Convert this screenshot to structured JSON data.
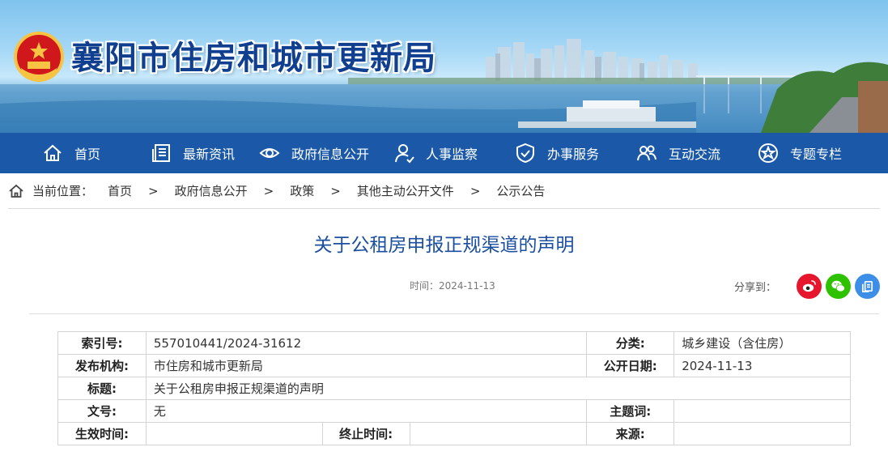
{
  "site": {
    "title": "襄阳市住房和城市更新局"
  },
  "nav": {
    "items": [
      {
        "label": "首页",
        "icon": "home-icon"
      },
      {
        "label": "最新资讯",
        "icon": "news-icon"
      },
      {
        "label": "政府信息公开",
        "icon": "eye-icon"
      },
      {
        "label": "人事监察",
        "icon": "person-icon"
      },
      {
        "label": "办事服务",
        "icon": "shield-icon"
      },
      {
        "label": "互动交流",
        "icon": "users-icon"
      },
      {
        "label": "专题专栏",
        "icon": "star-icon"
      }
    ]
  },
  "breadcrumb": {
    "label": "当前位置：",
    "separator": ">",
    "items": [
      "首页",
      "政府信息公开",
      "政策",
      "其他主动公开文件",
      "公示公告"
    ]
  },
  "article": {
    "title": "关于公租房申报正规渠道的声明",
    "time": "时间：2024-11-13",
    "share_label": "分享到："
  },
  "share_buttons": [
    {
      "icon": "weibo-icon",
      "color": "#e6162d"
    },
    {
      "icon": "wechat-icon",
      "color": "#2dc100"
    },
    {
      "icon": "copy-icon",
      "color": "#3d8ee6"
    }
  ],
  "info": {
    "index_key": "索引号:",
    "index_val": "557010441/2024-31612",
    "category_key": "分类:",
    "category_val": "城乡建设（含住房）",
    "publisher_key": "发布机构:",
    "publisher_val": "市住房和城市更新局",
    "date_key": "公开日期:",
    "date_val": "2024-11-13",
    "title_key": "标题:",
    "title_val": "关于公租房申报正规渠道的声明",
    "docno_key": "文号:",
    "docno_val": "无",
    "subject_key": "主题词:",
    "subject_val": "",
    "effective_key": "生效时间:",
    "effective_val": "",
    "expire_key": "终止时间:",
    "expire_val": "",
    "source_key": "来源:",
    "source_val": ""
  },
  "colors": {
    "nav_bg": "#1b59a8",
    "title_blue": "#1b4fa0",
    "banner_title": "#0f3f8e"
  }
}
